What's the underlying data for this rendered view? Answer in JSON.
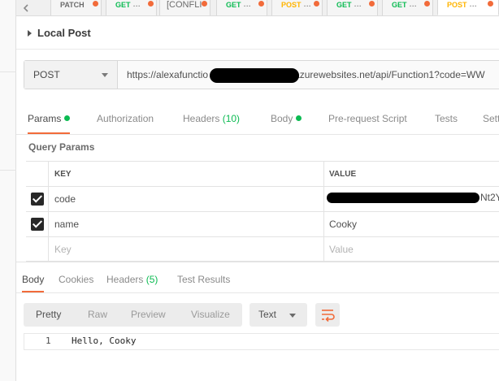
{
  "tab_bar": {
    "tabs": [
      {
        "method": "PATCH",
        "name": "",
        "has_dot": true
      },
      {
        "method": "GET",
        "name": "...",
        "has_dot": true
      },
      {
        "method": "",
        "name": "[CONFLI",
        "has_dot": true
      },
      {
        "method": "GET",
        "name": "...",
        "has_dot": true
      },
      {
        "method": "POST",
        "name": "...",
        "has_dot": true
      },
      {
        "method": "GET",
        "name": "...",
        "has_dot": true
      },
      {
        "method": "GET",
        "name": "...",
        "has_dot": true
      },
      {
        "method": "POST",
        "name": "...",
        "has_dot": true
      }
    ]
  },
  "request": {
    "title": "Local Post",
    "method": "POST",
    "url_prefix": "https://alexafunctio",
    "url_suffix": "8.azurewebsites.net/api/Function1?code=WW"
  },
  "request_tabs": {
    "params": "Params",
    "authorization": "Authorization",
    "headers": "Headers",
    "headers_count": "(10)",
    "body": "Body",
    "pre_request_script": "Pre-request Script",
    "tests": "Tests",
    "settings": "Sett"
  },
  "query_params": {
    "title": "Query Params",
    "columns": {
      "key": "KEY",
      "value": "VALUE"
    },
    "rows": [
      {
        "checked": true,
        "key": "code",
        "value": "Nt2Y"
      },
      {
        "checked": true,
        "key": "name",
        "value": "Cooky"
      }
    ],
    "new_row": {
      "key_placeholder": "Key",
      "value_placeholder": "Value"
    }
  },
  "response_tabs": {
    "body": "Body",
    "cookies": "Cookies",
    "headers": "Headers",
    "headers_count": "(5)",
    "test_results": "Test Results"
  },
  "response_view": {
    "pretty": "Pretty",
    "raw": "Raw",
    "preview": "Preview",
    "visualize": "Visualize",
    "format": "Text"
  },
  "response_body": {
    "line_number": "1",
    "content": "Hello, Cooky"
  },
  "colors": {
    "accent": "#f26b3a",
    "get": "#0cbb52",
    "post": "#ffb400",
    "dot": "#f26b3a"
  },
  "icons": {
    "tab_left_arrow": "chevron-left-icon",
    "collapse": "caret-right-icon",
    "method_dropdown": "chevron-down-icon",
    "format_dropdown": "chevron-down-icon",
    "wrap": "wrap-lines-icon",
    "checkbox": "checkbox-checked-icon"
  }
}
